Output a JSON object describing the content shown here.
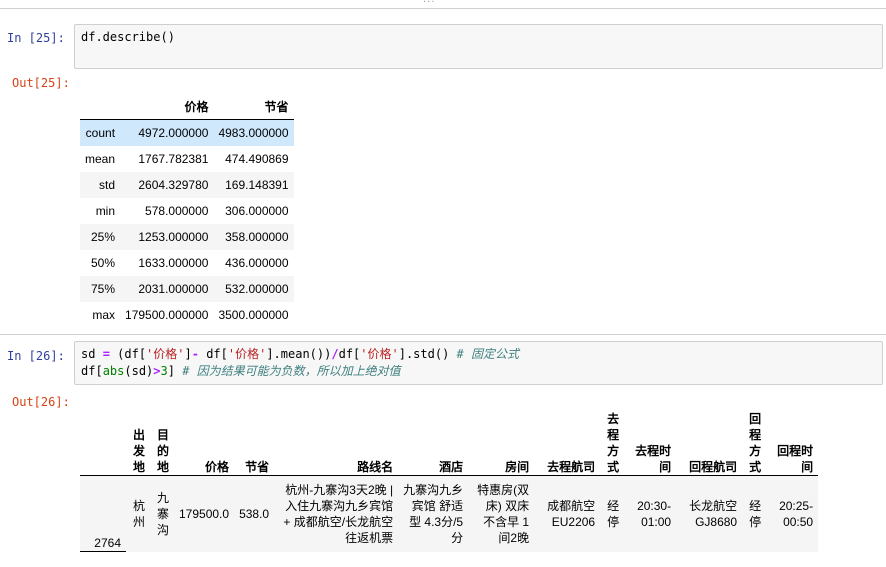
{
  "toolbar": {
    "dots": "..."
  },
  "cell25": {
    "in_prompt": "In  [25]:",
    "code": "df.describe()",
    "out_prompt": "Out[25]:",
    "table": {
      "columns": [
        "价格",
        "节省"
      ],
      "rows": [
        {
          "index": "count",
          "values": [
            "4972.000000",
            "4983.000000"
          ]
        },
        {
          "index": "mean",
          "values": [
            "1767.782381",
            "474.490869"
          ]
        },
        {
          "index": "std",
          "values": [
            "2604.329780",
            "169.148391"
          ]
        },
        {
          "index": "min",
          "values": [
            "578.000000",
            "306.000000"
          ]
        },
        {
          "index": "25%",
          "values": [
            "1253.000000",
            "358.000000"
          ]
        },
        {
          "index": "50%",
          "values": [
            "1633.000000",
            "436.000000"
          ]
        },
        {
          "index": "75%",
          "values": [
            "2031.000000",
            "532.000000"
          ]
        },
        {
          "index": "max",
          "values": [
            "179500.000000",
            "3500.000000"
          ]
        }
      ]
    }
  },
  "cell26": {
    "in_prompt": "In  [26]:",
    "line1": {
      "a": "sd ",
      "eq": "=",
      "b": " (df[",
      "s1": "'价格'",
      "c": "]",
      "minus": "-",
      "d": " df[",
      "s2": "'价格'",
      "e": "].mean())",
      "div": "/",
      "f": "df[",
      "s3": "'价格'",
      "g": "].std() ",
      "comment": "# 固定公式"
    },
    "line2": {
      "a": "df[",
      "abs": "abs",
      "b": "(sd)",
      "gt": ">",
      "three": "3",
      "c": "] ",
      "comment": "# 因为结果可能为负数，所以加上绝对值"
    },
    "out_prompt": "Out[26]:",
    "table": {
      "columns": [
        "出发地",
        "目的地",
        "价格",
        "节省",
        "路线名",
        "酒店",
        "房间",
        "去程航司",
        "去程方式",
        "去程时间",
        "回程航司",
        "回程方式",
        "回程时间"
      ],
      "rows": [
        {
          "index": "2764",
          "values": [
            "杭州",
            "九寨沟",
            "179500.0",
            "538.0",
            "杭州-九寨沟3天2晚 | 入住九寨沟九乡宾馆 + 成都航空/长龙航空往返机票",
            "九寨沟九乡宾馆 舒适型 4.3分/5分",
            "特惠房(双床) 双床 不含早 1间2晚",
            "成都航空 EU2206",
            "经停",
            "20:30-01:00",
            "长龙航空 GJ8680",
            "经停",
            "20:25-00:50"
          ]
        }
      ]
    }
  }
}
